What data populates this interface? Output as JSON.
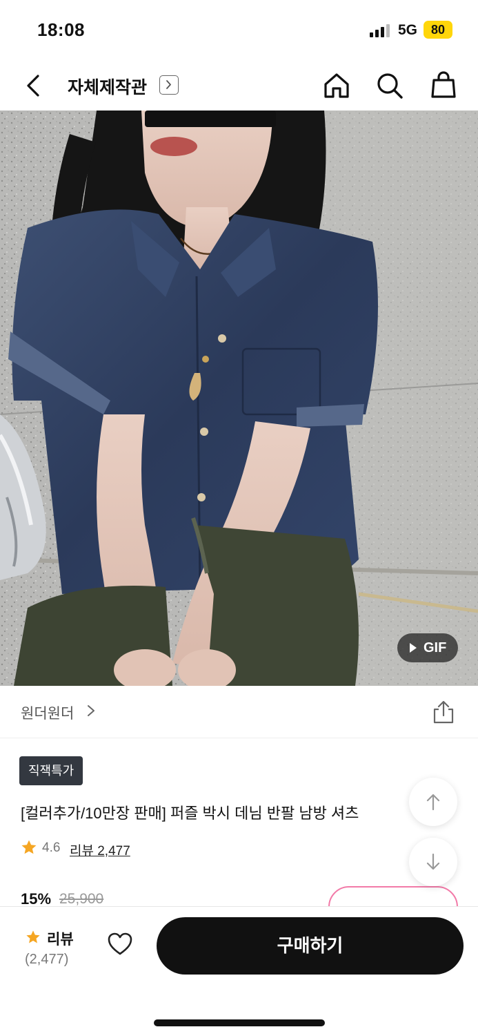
{
  "status_bar": {
    "time": "18:08",
    "network": "5G",
    "battery": "80"
  },
  "nav": {
    "title": "자체제작관",
    "icons": [
      "back-icon",
      "home-icon",
      "search-icon",
      "shopping-bag-icon"
    ]
  },
  "hero": {
    "gif_label": "GIF"
  },
  "brand": {
    "name": "원더원더"
  },
  "product": {
    "badge": "직잭특가",
    "title": "[컬러추가/10만장 판매] 퍼즐 박시 데님 반팔 남방 셔츠",
    "rating": "4.6",
    "review_link": "리뷰 2,477",
    "discount": "15%",
    "original_price": "25,900"
  },
  "bottom_bar": {
    "review_label": "리뷰",
    "review_count": "(2,477)",
    "buy_label": "구매하기"
  },
  "colors": {
    "star": "#f5a623",
    "buy_button": "#111111",
    "coupon_accent": "#f27aa8",
    "battery": "#ffd60a"
  }
}
